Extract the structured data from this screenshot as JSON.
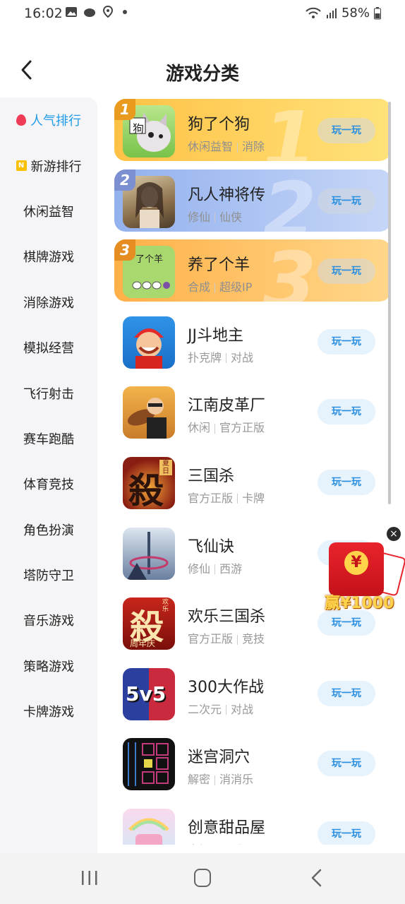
{
  "status": {
    "time": "16:02",
    "battery": "58%"
  },
  "header": {
    "title": "游戏分类"
  },
  "sidebar": {
    "items": [
      {
        "label": "人气排行",
        "icon": "flame-icon",
        "active": true
      },
      {
        "label": "新游排行",
        "icon": "new-badge-icon",
        "badge": "N"
      },
      {
        "label": "休闲益智"
      },
      {
        "label": "棋牌游戏"
      },
      {
        "label": "消除游戏"
      },
      {
        "label": "模拟经营"
      },
      {
        "label": "飞行射击"
      },
      {
        "label": "赛车跑酷"
      },
      {
        "label": "体育竞技"
      },
      {
        "label": "角色扮演"
      },
      {
        "label": "塔防守卫"
      },
      {
        "label": "音乐游戏"
      },
      {
        "label": "策略游戏"
      },
      {
        "label": "卡牌游戏"
      }
    ]
  },
  "games": [
    {
      "rank": "1",
      "name": "狗了个狗",
      "tags": [
        "休闲益智",
        "消除"
      ],
      "play": "玩一玩",
      "thumb_text": "狗"
    },
    {
      "rank": "2",
      "name": "凡人神将传",
      "tags": [
        "修仙",
        "仙侠"
      ],
      "play": "玩一玩"
    },
    {
      "rank": "3",
      "name": "养了个羊",
      "tags": [
        "合成",
        "超级IP"
      ],
      "play": "玩一玩",
      "thumb_text": "了个羊"
    },
    {
      "name": "JJ斗地主",
      "tags": [
        "扑克牌",
        "对战"
      ],
      "play": "玩一玩"
    },
    {
      "name": "江南皮革厂",
      "tags": [
        "休闲",
        "官方正版"
      ],
      "play": "玩一玩"
    },
    {
      "name": "三国杀",
      "tags": [
        "官方正版",
        "卡牌"
      ],
      "play": "玩一玩",
      "thumb_text": "殺",
      "thumb_sub": "夏日"
    },
    {
      "name": "飞仙诀",
      "tags": [
        "修仙",
        "西游"
      ],
      "play": "玩一玩"
    },
    {
      "name": "欢乐三国杀",
      "tags": [
        "官方正版",
        "竞技"
      ],
      "play": "玩一玩",
      "thumb_text": "殺",
      "thumb_sub": "周年庆",
      "thumb_corner": "欢乐"
    },
    {
      "name": "300大作战",
      "tags": [
        "二次元",
        "对战"
      ],
      "play": "玩一玩",
      "thumb_text": "5v5"
    },
    {
      "name": "迷宫洞穴",
      "tags": [
        "解密",
        "消消乐"
      ],
      "play": "玩一玩"
    },
    {
      "name": "创意甜品屋",
      "tags": [
        "烹饪",
        "可爱"
      ],
      "play": "玩一玩"
    }
  ],
  "floating": {
    "amount": "赢¥1000",
    "symbol": "¥",
    "close": "×"
  }
}
